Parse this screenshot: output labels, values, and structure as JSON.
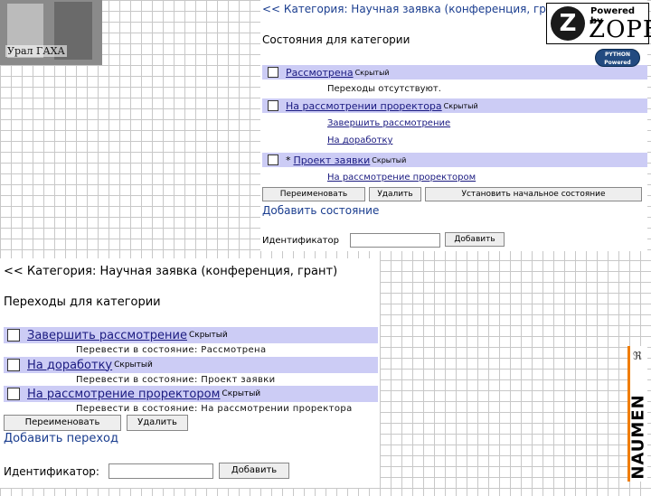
{
  "logos": {
    "top_left_text": "Урал ГАХА",
    "zope_powered": "Powered by",
    "zope_word": "ZOPE",
    "zope_letter": "Z",
    "python_badge": "PYTHON Powered",
    "vertical_logo": "NAUMEN",
    "vertical_mark": "ℜ"
  },
  "states_panel": {
    "breadcrumb": "<< Категория: Научная заявка (конференция, грант)",
    "heading": "Состояния для категории",
    "states": [
      {
        "name": "Рассмотрена",
        "tag": "Скрытый",
        "subs": [
          {
            "text": "Переходы отсутствуют.",
            "link": false
          }
        ]
      },
      {
        "name": "На рассмотрении проректора",
        "tag": "Скрытый",
        "subs": [
          {
            "text": "Завершить рассмотрение",
            "link": true
          },
          {
            "text": "На доработку",
            "link": true
          }
        ]
      },
      {
        "name": "Проект заявки",
        "tag": "Скрытый",
        "prefix": "*",
        "subs": [
          {
            "text": "На рассмотрение проректором",
            "link": true
          }
        ]
      }
    ],
    "buttons": {
      "rename": "Переименовать",
      "delete": "Удалить",
      "set_initial": "Установить начальное состояние"
    },
    "add_title": "Добавить состояние",
    "id_label": "Идентификатор",
    "id_value": "",
    "add_button": "Добавить"
  },
  "transitions_panel": {
    "breadcrumb": "<< Категория: Научная заявка (конференция, грант)",
    "heading": "Переходы для категории",
    "transitions": [
      {
        "name": "Завершить рассмотрение",
        "tag": "Скрытый",
        "target": "Перевести в состояние: Рассмотрена"
      },
      {
        "name": "На доработку",
        "tag": "Скрытый",
        "target": "Перевести в состояние: Проект заявки"
      },
      {
        "name": "На рассмотрение проректором",
        "tag": "Скрытый",
        "target": "Перевести в состояние: На рассмотрении проректора"
      }
    ],
    "buttons": {
      "rename": "Переименовать",
      "delete": "Удалить"
    },
    "add_title": "Добавить переход",
    "id_label": "Идентификатор:",
    "id_value": "",
    "add_button": "Добавить"
  }
}
